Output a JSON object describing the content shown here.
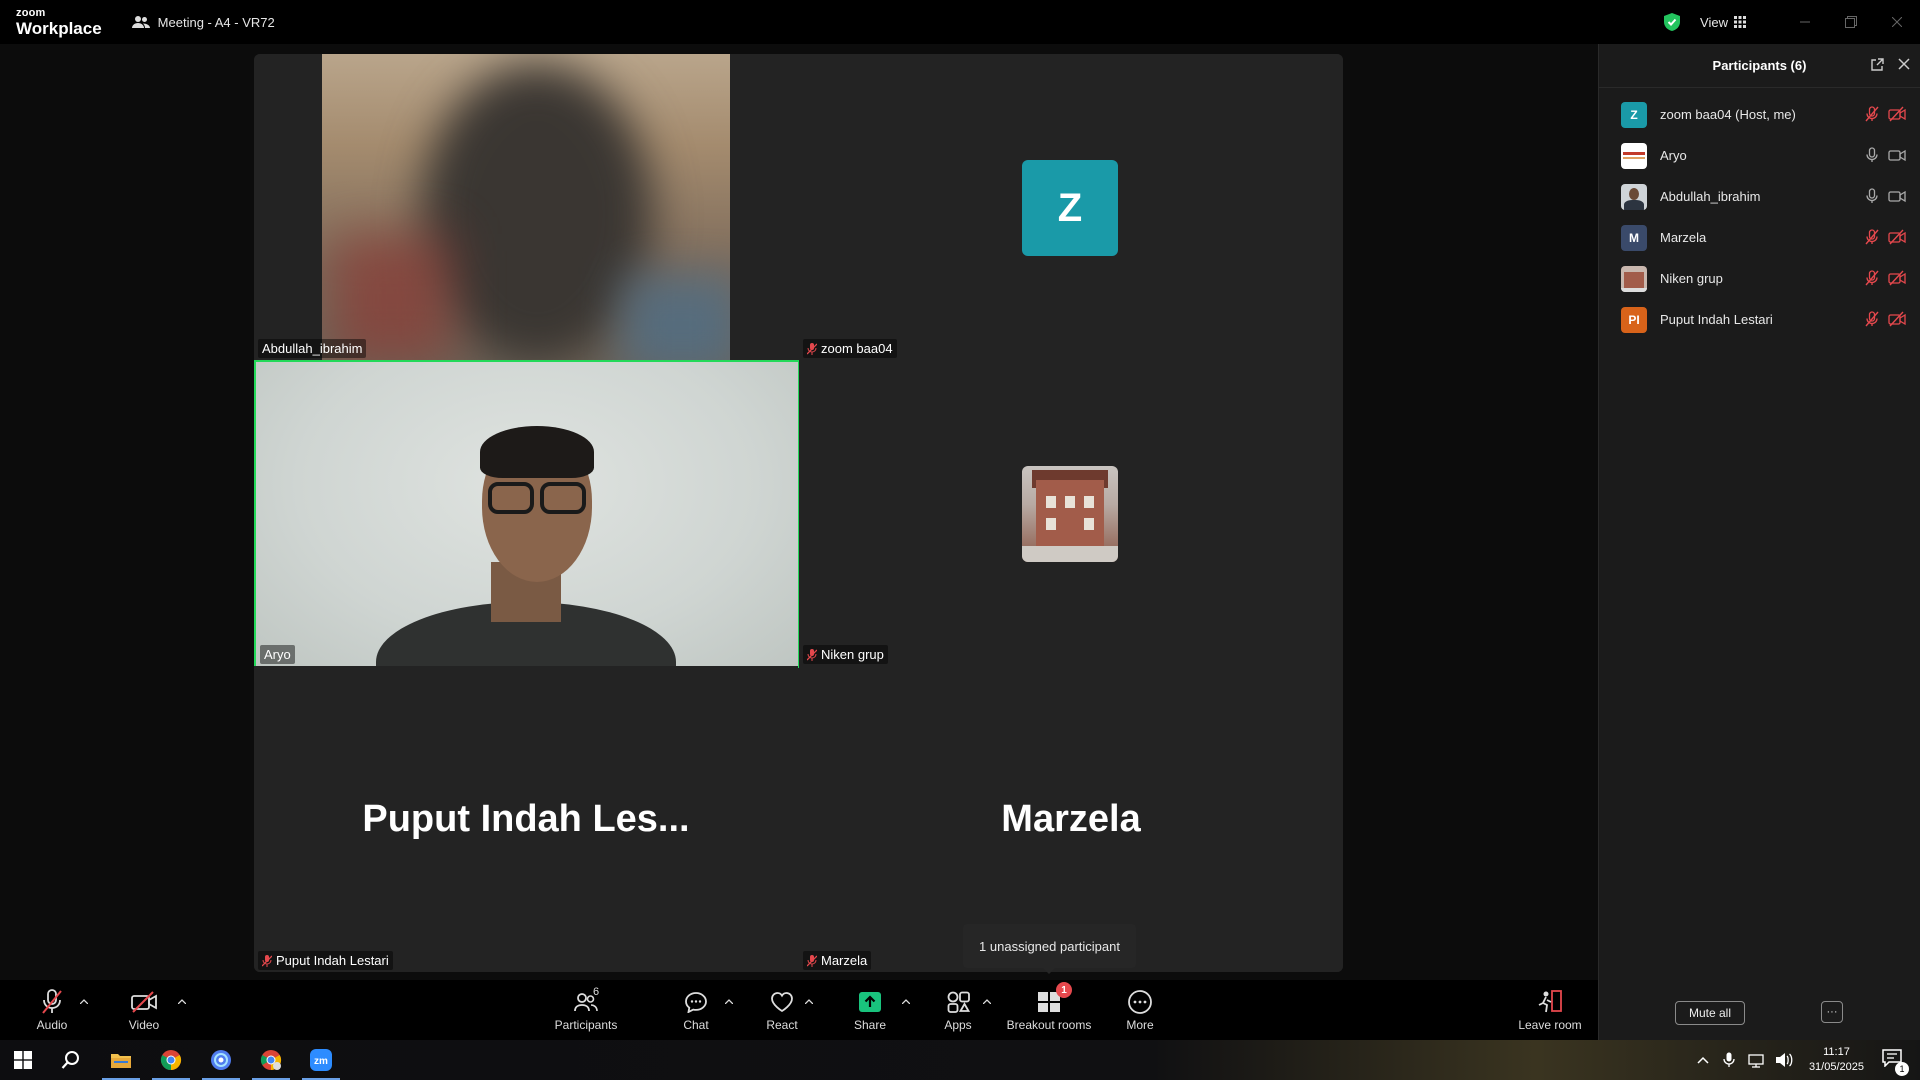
{
  "titlebar": {
    "logo_line1": "zoom",
    "logo_line2": "Workplace",
    "meeting_title": "Meeting - A4 - VR72",
    "view_label": "View"
  },
  "tiles": {
    "abdullah": {
      "name": "Abdullah_ibrahim"
    },
    "zoom": {
      "name": "zoom baa04",
      "initial": "Z"
    },
    "aryo": {
      "name": "Aryo"
    },
    "niken": {
      "name": "Niken grup"
    },
    "puput": {
      "name": "Puput Indah Lestari",
      "display": "Puput Indah Les..."
    },
    "marzela": {
      "name": "Marzela",
      "display": "Marzela"
    }
  },
  "tooltip": "1 unassigned participant",
  "toolbar": {
    "audio": "Audio",
    "video": "Video",
    "participants": "Participants",
    "participants_count": "6",
    "chat": "Chat",
    "react": "React",
    "share": "Share",
    "apps": "Apps",
    "breakout": "Breakout rooms",
    "breakout_badge": "1",
    "more": "More",
    "leave": "Leave room"
  },
  "panel": {
    "title": "Participants (6)",
    "participants": [
      {
        "name": "zoom baa04 (Host, me)",
        "initial": "Z",
        "color": "#1a9aa8",
        "mic": "muted",
        "cam": "off"
      },
      {
        "name": "Aryo",
        "initial": "",
        "color": "#ffffff",
        "mic": "on",
        "cam": "on"
      },
      {
        "name": "Abdullah_ibrahim",
        "initial": "",
        "color": "#5a6470",
        "mic": "on",
        "cam": "on"
      },
      {
        "name": "Marzela",
        "initial": "M",
        "color": "#3a4a6a",
        "mic": "muted",
        "cam": "off"
      },
      {
        "name": "Niken grup",
        "initial": "",
        "color": "#b07a6a",
        "mic": "muted",
        "cam": "off"
      },
      {
        "name": "Puput Indah Lestari",
        "initial": "PI",
        "color": "#d8631a",
        "mic": "muted",
        "cam": "off"
      }
    ],
    "mute_all": "Mute all",
    "more": "···"
  },
  "taskbar": {
    "time": "11:17",
    "date": "31/05/2025",
    "notif_count": "1"
  },
  "colors": {
    "active_speaker": "#23d959",
    "muted_red": "#e5484d",
    "share_green": "#19c37d"
  }
}
